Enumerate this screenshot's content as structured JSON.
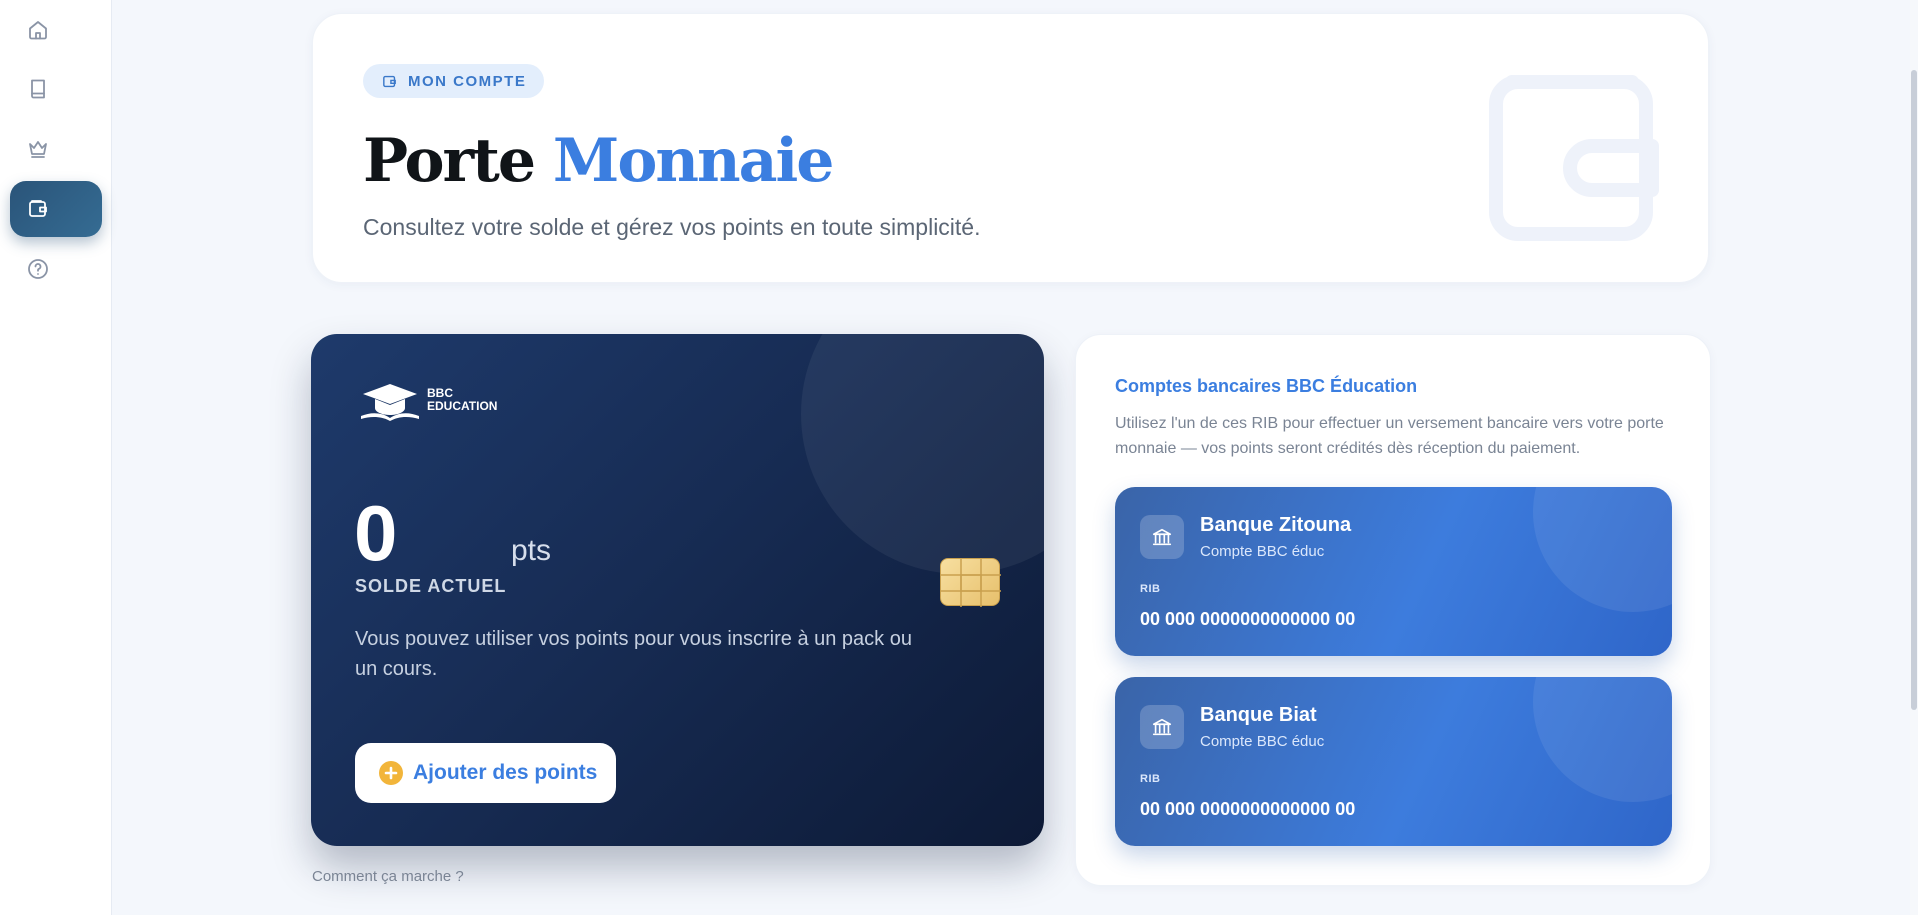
{
  "sidebar": {
    "items": [
      {
        "name": "home",
        "icon": "home-icon",
        "active": false
      },
      {
        "name": "courses",
        "icon": "book-icon",
        "active": false
      },
      {
        "name": "packs",
        "icon": "crown-icon",
        "active": false
      },
      {
        "name": "wallet",
        "icon": "wallet-icon",
        "active": true
      },
      {
        "name": "help",
        "icon": "help-circle-icon",
        "active": false
      }
    ]
  },
  "header": {
    "badge": "MON COMPTE",
    "title_part1": "Porte",
    "title_part2": "Monnaie",
    "subtitle": "Consultez votre solde et gérez vos points en toute simplicité."
  },
  "balance_card": {
    "logo_line1": "BBC",
    "logo_line2": "EDUCATION",
    "balance": "0",
    "unit": "pts",
    "label": "SOLDE ACTUEL",
    "description": "Vous pouvez utiliser vos points pour vous inscrire à un pack ou un cours.",
    "button_label": "Ajouter des points"
  },
  "how_it_works": "Comment ça marche ?",
  "bank_panel": {
    "title": "Comptes bancaires BBC Éducation",
    "description": "Utilisez l'un de ces RIB pour effectuer un versement bancaire vers votre porte monnaie — vos points seront crédités dès réception du paiement.",
    "banks": [
      {
        "name": "Banque Zitouna",
        "sub": "Compte BBC éduc",
        "rib_label": "RIB",
        "rib": "00 000 0000000000000 00"
      },
      {
        "name": "Banque Biat",
        "sub": "Compte BBC éduc",
        "rib_label": "RIB",
        "rib": "00 000 0000000000000 00"
      }
    ]
  },
  "colors": {
    "accent": "#3b7ee0",
    "sidebar_active": "#2a5479",
    "card_dark": "#172c54",
    "bank_card": "#3d7cdd",
    "button_plus": "#f2b53a"
  }
}
